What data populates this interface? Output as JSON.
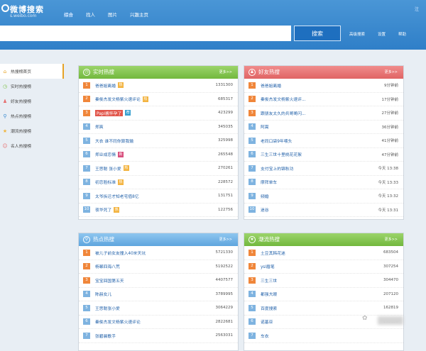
{
  "header": {
    "logo": "微博搜索",
    "logo_sub": "s.weibo.com",
    "nav": [
      "综合",
      "找人",
      "图片",
      "兴趣主页"
    ],
    "search_button": "搜索",
    "right_links": [
      "高级搜索",
      "设置",
      "帮助"
    ],
    "corner": "注"
  },
  "sidebar": {
    "items": [
      {
        "label": "热搜榜首页",
        "icon": "home-icon"
      },
      {
        "label": "实时热搜榜",
        "icon": "clock-icon"
      },
      {
        "label": "好友热搜榜",
        "icon": "friends-icon"
      },
      {
        "label": "热点热搜榜",
        "icon": "search-icon"
      },
      {
        "label": "潮流热搜榜",
        "icon": "star-icon"
      },
      {
        "label": "名人热搜榜",
        "icon": "person-icon"
      }
    ]
  },
  "panels": {
    "realtime": {
      "title": "实时热搜",
      "more": "更多>>",
      "rows": [
        {
          "n": "1",
          "t": "爸爸姐离婚",
          "b": "热",
          "v": "1331300"
        },
        {
          "n": "2",
          "t": "秦俊杰发文杨紫火速评论",
          "b": "热",
          "v": "685317"
        },
        {
          "n": "3",
          "t": "Papi酱怀孕了",
          "b": "荐",
          "v": "423299"
        },
        {
          "n": "4",
          "t": "郑爽",
          "b": "",
          "v": "345035"
        },
        {
          "n": "5",
          "t": "大衣 谁不同你算我输",
          "b": "",
          "v": "325998"
        },
        {
          "n": "6",
          "t": "郑业成恋情",
          "b": "新",
          "v": "265548"
        },
        {
          "n": "7",
          "t": "王思聪 张小爱",
          "b": "热",
          "v": "270261"
        },
        {
          "n": "8",
          "t": "初恋脸标准",
          "b": "热",
          "v": "228572"
        },
        {
          "n": "9",
          "t": "太爷拆迁才知老宅值8亿",
          "b": "",
          "v": "131751"
        },
        {
          "n": "10",
          "t": "夜华死了",
          "b": "热",
          "v": "122756"
        }
      ]
    },
    "friends": {
      "title": "好友热搜",
      "more": "更多>>",
      "rows": [
        {
          "n": "1",
          "t": "爸爸姐离婚",
          "v": "9分钟前"
        },
        {
          "n": "2",
          "t": "秦俊杰发文杨紫火速评...",
          "v": "17分钟前"
        },
        {
          "n": "3",
          "t": "跟朋友太久的兵哥哥闪...",
          "v": "27分钟前"
        },
        {
          "n": "4",
          "t": "阿嵩",
          "v": "36分钟前"
        },
        {
          "n": "5",
          "t": "老同口袋9年喂头",
          "v": "41分钟前"
        },
        {
          "n": "6",
          "t": "三生三世十里桃花花絮",
          "v": "47分钟前"
        },
        {
          "n": "7",
          "t": "支付宝上的锦秋功",
          "v": "今天 13:38"
        },
        {
          "n": "8",
          "t": "摩拜单车",
          "v": "今天 13:33"
        },
        {
          "n": "9",
          "t": "频婚",
          "v": "今天 13:32"
        },
        {
          "n": "10",
          "t": "迷谷",
          "v": "今天 13:31"
        }
      ]
    },
    "hotspot": {
      "title": "热点热搜",
      "more": "更多>>",
      "rows": [
        {
          "n": "1",
          "t": "被儿子前女友撞入40米天坑",
          "v": "5721330"
        },
        {
          "n": "2",
          "t": "杨幂四海八荒",
          "v": "5192522"
        },
        {
          "n": "3",
          "t": "宝宝回国第五天",
          "v": "4407577"
        },
        {
          "n": "4",
          "t": "陈赫女儿",
          "v": "3789995"
        },
        {
          "n": "5",
          "t": "王思聪张小爱",
          "v": "3064229"
        },
        {
          "n": "6",
          "t": "秦俊杰发文杨紫火速评论",
          "v": "2822681"
        },
        {
          "n": "7",
          "t": "张碧晨歌手",
          "v": "2563031"
        }
      ]
    },
    "trend": {
      "title": "潮流热搜",
      "more": "更多>>",
      "rows": [
        {
          "n": "1",
          "t": "土豆其韩花迷",
          "v": "683504"
        },
        {
          "n": "2",
          "t": "ysl眉笔",
          "v": "307254"
        },
        {
          "n": "3",
          "t": "三生三世",
          "v": "304470"
        },
        {
          "n": "4",
          "t": "都强大眼",
          "v": "207120"
        },
        {
          "n": "5",
          "t": "百度搜索",
          "v": "162819"
        },
        {
          "n": "6",
          "t": "诺基亚",
          "v": "155359"
        },
        {
          "n": "7",
          "t": "车衣",
          "v": ""
        }
      ]
    }
  },
  "colors": {
    "header": "#3a8ad0",
    "green": "#7fc24a",
    "red": "#e67070",
    "blue": "#6aafe2",
    "hot": "#f0863a",
    "cool": "#7eb3e0"
  }
}
